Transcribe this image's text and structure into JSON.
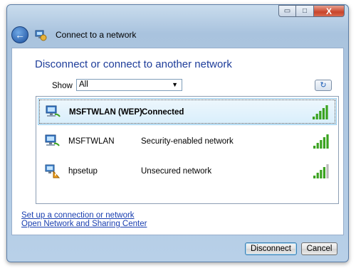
{
  "window": {
    "title": "Connect to a network",
    "minimize_glyph": "▭",
    "maximize_glyph": "□",
    "close_glyph": "X",
    "back_glyph": "←"
  },
  "main": {
    "heading": "Disconnect or connect to another network",
    "show_label": "Show",
    "show_value": "All",
    "refresh_glyph": "↻"
  },
  "networks": [
    {
      "name": "MSFTWLAN (WEP)",
      "status": "Connected",
      "icon": "wireless-network-icon",
      "signal_bars": 5,
      "selected": true
    },
    {
      "name": "MSFTWLAN",
      "status": "Security-enabled network",
      "icon": "wireless-network-icon",
      "signal_bars": 5,
      "selected": false
    },
    {
      "name": "hpsetup",
      "status": "Unsecured network",
      "icon": "unsecured-network-icon",
      "signal_bars": 4,
      "selected": false
    }
  ],
  "links": {
    "setup": "Set up a connection or network",
    "sharing": "Open Network and Sharing Center"
  },
  "buttons": {
    "disconnect": "Disconnect",
    "cancel": "Cancel"
  },
  "colors": {
    "heading": "#1e3d9a",
    "link": "#1a3fb0",
    "signal_on": "#3aa31f",
    "signal_off": "#b9b9b9"
  }
}
